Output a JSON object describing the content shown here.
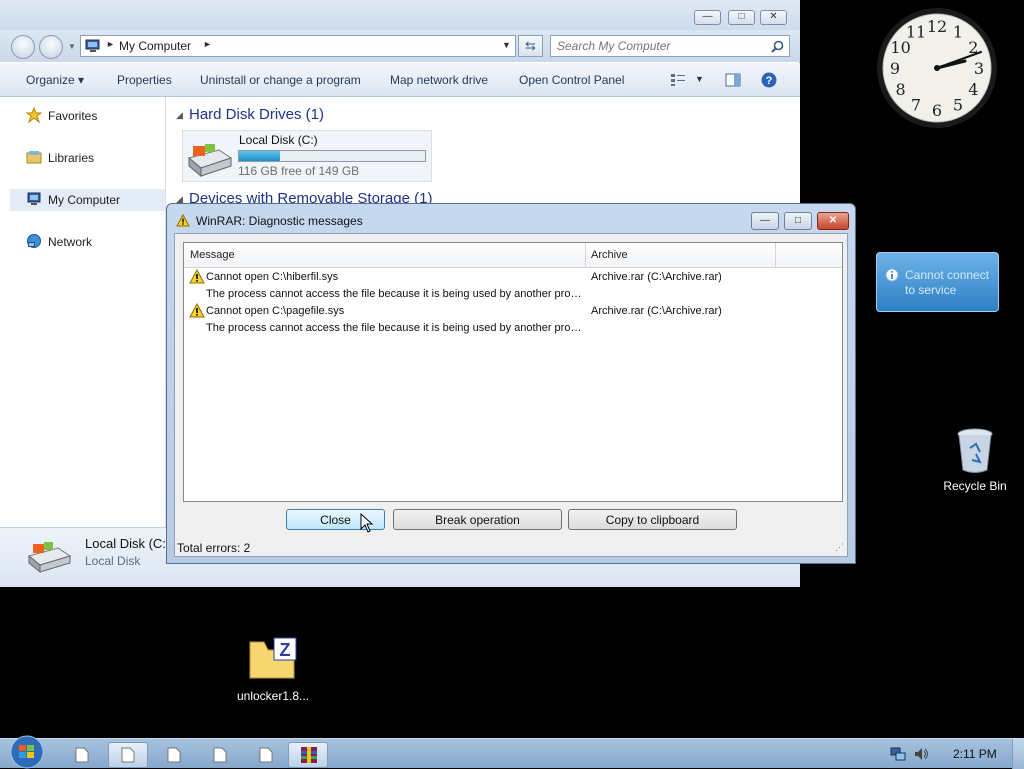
{
  "explorer": {
    "address": "My Computer",
    "search_placeholder": "Search My Computer",
    "toolbar": {
      "organize": "Organize",
      "properties": "Properties",
      "uninstall": "Uninstall or change a program",
      "map_drive": "Map network drive",
      "control_panel": "Open Control Panel"
    },
    "nav": {
      "favorites": "Favorites",
      "libraries": "Libraries",
      "my_computer": "My Computer",
      "network": "Network"
    },
    "content": {
      "hard_disk_header": "Hard Disk Drives (1)",
      "removable_header": "Devices with Removable Storage (1)",
      "drive_name": "Local Disk (C:)",
      "drive_free": "116 GB free of 149 GB",
      "drive_used_fraction": 0.22
    },
    "details": {
      "title": "Local Disk (C:)",
      "subtitle": "Local Disk"
    }
  },
  "dialog": {
    "title": "WinRAR: Diagnostic messages",
    "columns": {
      "message": "Message",
      "archive": "Archive"
    },
    "rows": [
      {
        "message": "Cannot open C:\\hiberfil.sys",
        "detail": "The process cannot access the file because it is being used by another proc...",
        "archive": "Archive.rar (C:\\Archive.rar)"
      },
      {
        "message": "Cannot open C:\\pagefile.sys",
        "detail": "The process cannot access the file because it is being used by another proc...",
        "archive": "Archive.rar (C:\\Archive.rar)"
      }
    ],
    "buttons": {
      "close": "Close",
      "break": "Break operation",
      "copy": "Copy to clipboard"
    },
    "status": "Total errors: 2"
  },
  "desktop": {
    "notification": "Cannot connect to service",
    "recycle_bin": "Recycle Bin",
    "file_icon_label": "unlocker1.8...",
    "clock_numbers": [
      "12",
      "1",
      "2",
      "3",
      "4",
      "5",
      "6",
      "7",
      "8",
      "9",
      "10",
      "11"
    ]
  },
  "taskbar": {
    "time": "2:11 PM"
  },
  "colors": {
    "accent": "#1e3287",
    "progress": "#1f8fc5",
    "desktop": "#000000"
  }
}
